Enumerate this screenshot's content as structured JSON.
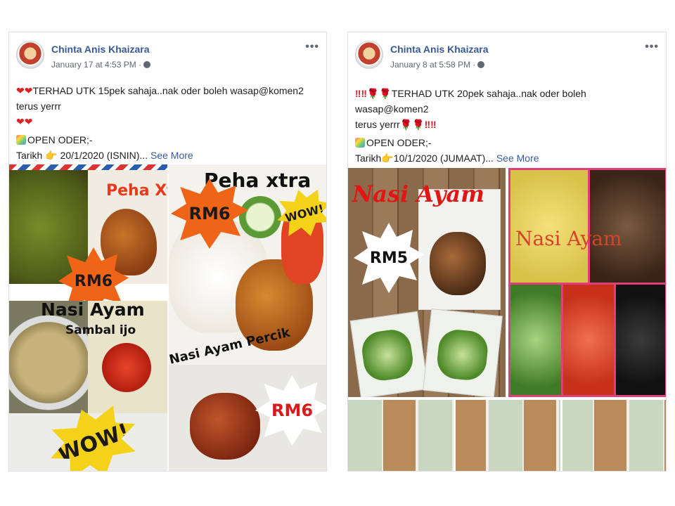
{
  "posts": [
    {
      "author": "Chinta Anis Khaizara",
      "timestamp": "January 17 at 4:53 PM",
      "menu": "•••",
      "line1_prefix": "❤❤",
      "line1": "TERHAD UTK 15pek sahaja..nak oder boleh wasap@komen2 terus yerrr",
      "line2": "❤❤",
      "line3": "OPEN ODER;-",
      "line4_a": "Tarikh",
      "line4_finger": "👉",
      "line4_b": "20/1/2020 (ISNIN)...",
      "see_more": "See More",
      "image_labels": {
        "peha_xtra_small": "Peha Xtra",
        "rm6_a": "RM6",
        "nasi_ayam": "Nasi Ayam",
        "sambal_ijo": "Sambal ijo",
        "wow_a": "WOW!",
        "peha_xtra_big": "Peha xtra",
        "rm6_b": "RM6",
        "wow_b": "WOW!",
        "nasi_ayam_percik": "Nasi Ayam Percik",
        "rm6_c": "RM6"
      }
    },
    {
      "author": "Chinta Anis Khaizara",
      "timestamp": "January 8 at 5:58 PM",
      "menu": "•••",
      "line1_prefix": "‼‼🌹🌹",
      "line1": "TERHAD UTK 20pek sahaja..nak oder boleh wasap@komen2",
      "line2": "terus yerrr",
      "line2_suffix": "🌹🌹‼‼",
      "line3": "OPEN ODER;-",
      "line4_a": "Tarikh",
      "line4_finger": "👉",
      "line4_b": "10/1/2020 (JUMAAT)...",
      "see_more": "See More",
      "image_labels": {
        "nasi_ayam_red": "Nasi Ayam",
        "rm5": "RM5",
        "nasi_ayam_yellow": "Nasi Ayam"
      }
    }
  ],
  "colors": {
    "link": "#385898",
    "accent_red": "#e02020",
    "orange_burst": "#f06418",
    "border": "#dddfe2"
  }
}
